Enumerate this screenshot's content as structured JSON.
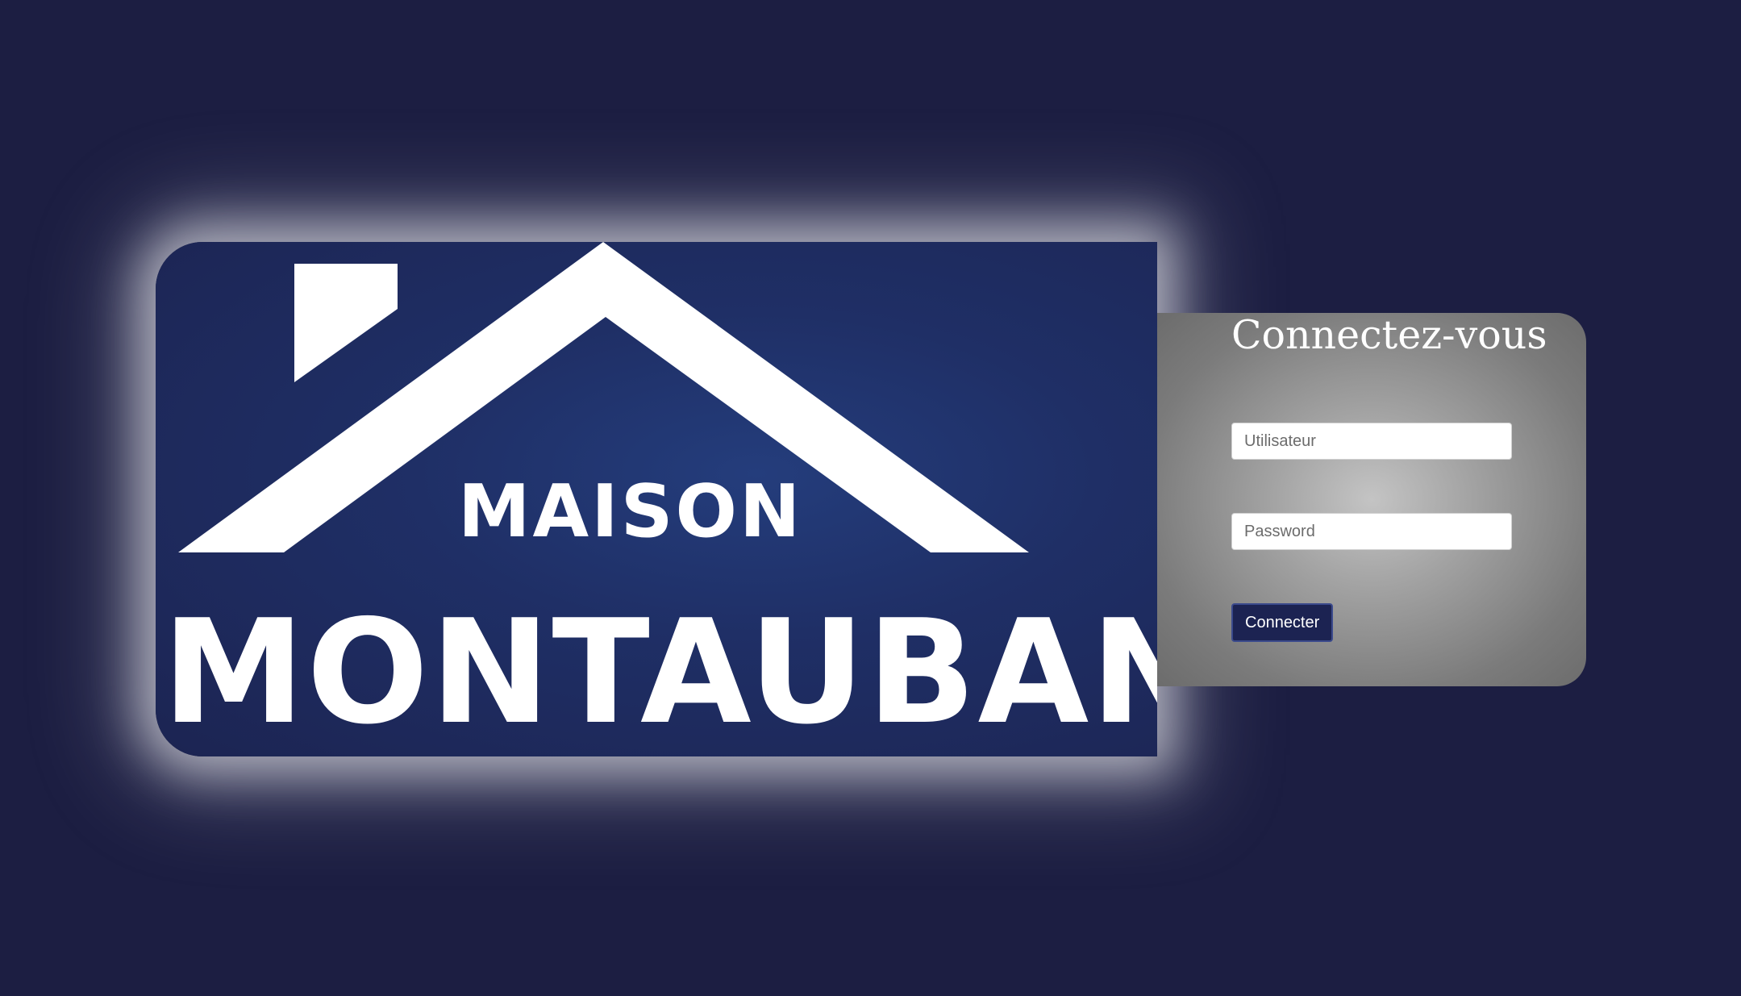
{
  "logo": {
    "line1": "MAISON",
    "line2": "MONTAUBAN"
  },
  "login": {
    "title": "Connectez-vous",
    "username_placeholder": "Utilisateur",
    "username_value": "",
    "password_placeholder": "Password",
    "password_value": "",
    "submit_label": "Connecter"
  },
  "colors": {
    "page_background": "#1c1e42",
    "logo_background": "#243d7c",
    "button_background": "#1c2352",
    "panel_gray": "#a1a1a1"
  },
  "icons": {
    "logo_mark": "house-roof-icon"
  }
}
